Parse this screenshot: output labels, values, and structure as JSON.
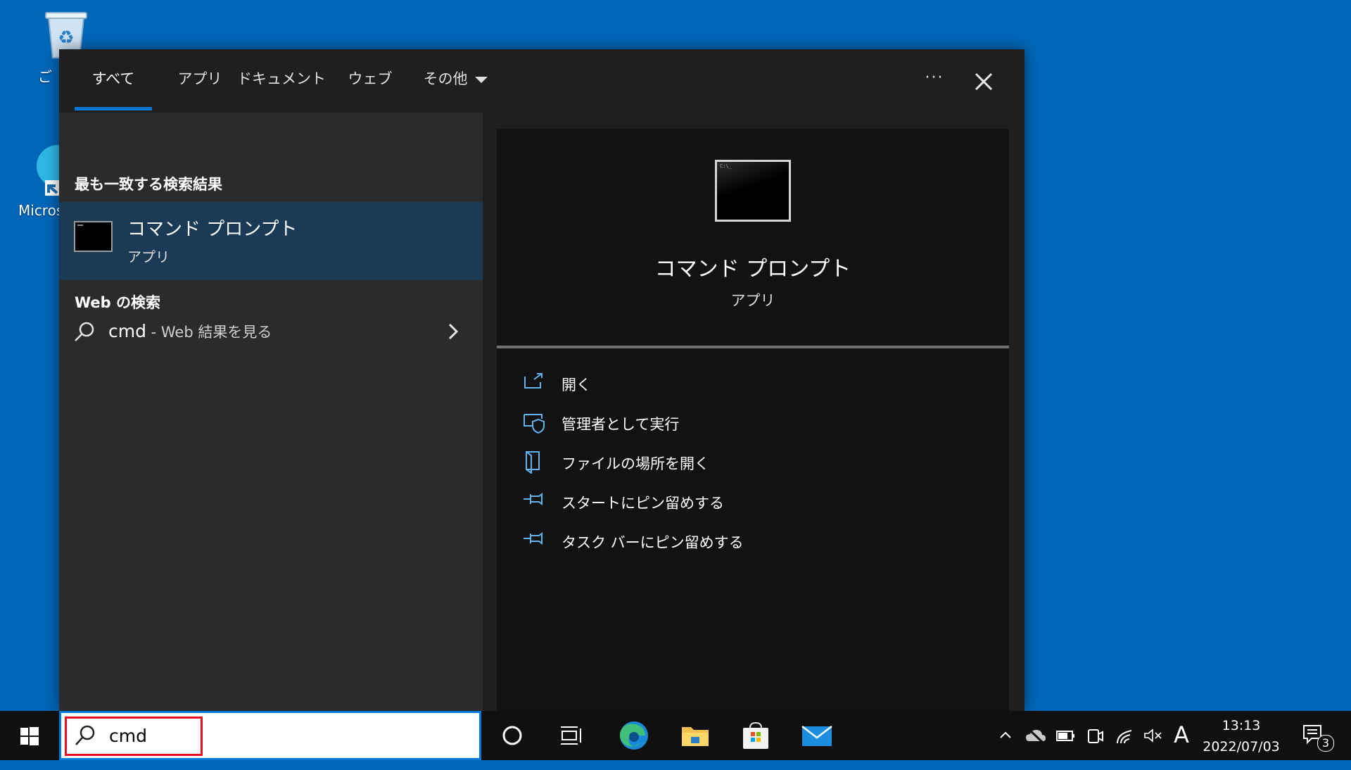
{
  "desktop": {
    "icons": [
      {
        "label": "ご"
      },
      {
        "label": "Micros"
      }
    ]
  },
  "search_panel": {
    "tabs": [
      {
        "label": "すべて",
        "active": true
      },
      {
        "label": "アプリ"
      },
      {
        "label": "ドキュメント"
      },
      {
        "label": "ウェブ"
      },
      {
        "label": "その他"
      }
    ],
    "more_label": "···",
    "best_match": {
      "heading": "最も一致する検索結果",
      "title": "コマンド プロンプト",
      "subtitle": "アプリ"
    },
    "web_search": {
      "heading": "Web の検索",
      "query": "cmd",
      "suffix": " - Web 結果を見る"
    },
    "preview": {
      "title": "コマンド プロンプト",
      "subtitle": "アプリ",
      "actions": [
        {
          "label": "開く",
          "icon": "open-icon"
        },
        {
          "label": "管理者として実行",
          "icon": "admin-shield-icon"
        },
        {
          "label": "ファイルの場所を開く",
          "icon": "file-location-icon"
        },
        {
          "label": "スタートにピン留めする",
          "icon": "pin-icon"
        },
        {
          "label": "タスク バーにピン留めする",
          "icon": "pin-icon"
        }
      ]
    }
  },
  "taskbar": {
    "search_value": "cmd",
    "clock": {
      "time": "13:13",
      "date": "2022/07/03"
    },
    "ime": "A",
    "notification_count": "3"
  },
  "colors": {
    "desktop": "#0067b8",
    "accent": "#0078d7",
    "highlight_box": "#e81123"
  }
}
